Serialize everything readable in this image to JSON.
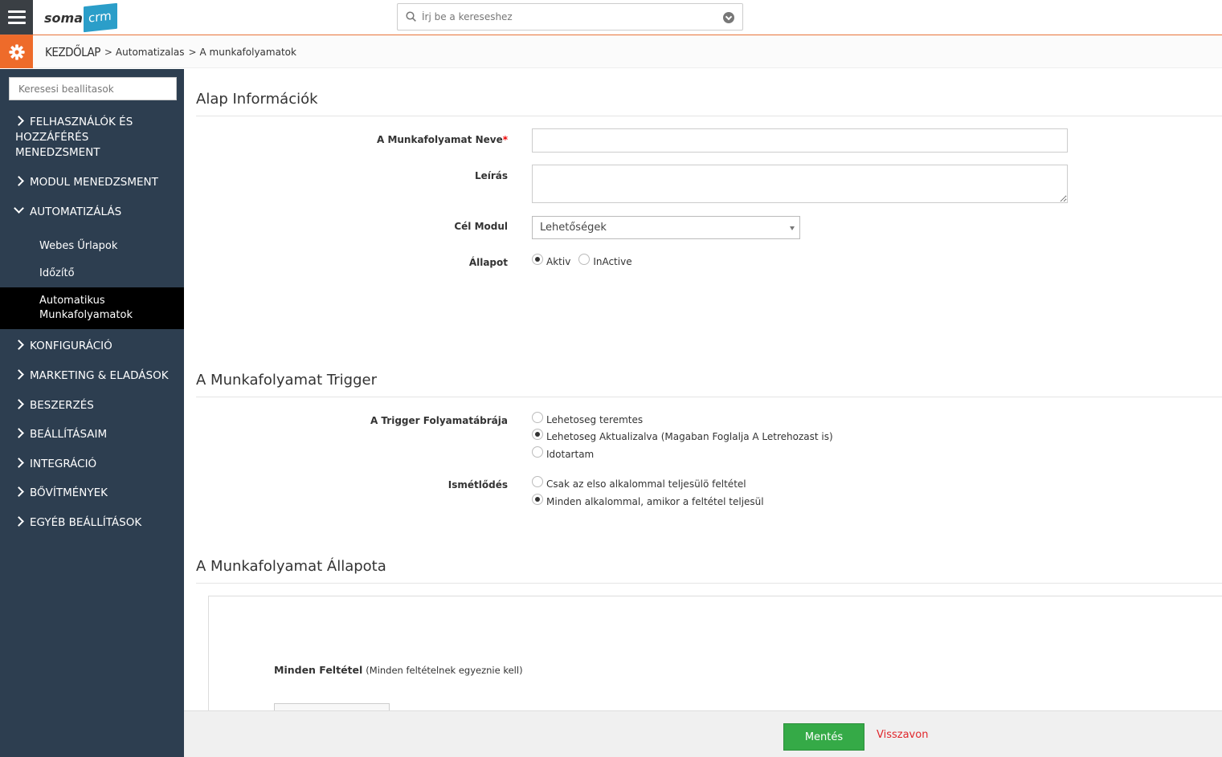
{
  "header": {
    "logo_text_1": "soma",
    "logo_text_2": "crm",
    "search_placeholder": "Írj be a kereseshez"
  },
  "breadcrumb": {
    "home": "KEZDŐLAP",
    "items": [
      "Automatizalas",
      "A munkafolyamatok"
    ]
  },
  "sidebar": {
    "search_placeholder": "Keresesi beallitasok",
    "items": [
      {
        "label": "FELHASZNÁLÓK ÉS HOZZÁFÉRÉS MENEDZSMENT"
      },
      {
        "label": "MODUL MENEDZSMENT"
      },
      {
        "label": "AUTOMATIZÁLÁS"
      },
      {
        "label": "KONFIGURÁCIÓ"
      },
      {
        "label": "MARKETING & ELADÁSOK"
      },
      {
        "label": "BESZERZÉS"
      },
      {
        "label": "BEÁLLÍTÁSAIM"
      },
      {
        "label": "INTEGRÁCIÓ"
      },
      {
        "label": "BŐVÍTMÉNYEK"
      },
      {
        "label": "EGYÉB BEÁLLÍTÁSOK"
      }
    ],
    "sub_items": [
      {
        "label": "Webes Űrlapok"
      },
      {
        "label": "Időzítő"
      },
      {
        "label": "Automatikus Munkafolyamatok",
        "active": true
      }
    ]
  },
  "basic_info": {
    "title": "Alap Információk",
    "name_label": "A Munkafolyamat Neve",
    "name_value": "",
    "desc_label": "Leírás",
    "desc_value": "",
    "module_label": "Cél Modul",
    "module_value": "Lehetőségek",
    "status_label": "Állapot",
    "status_options": [
      "Aktiv",
      "InActive"
    ],
    "status_selected": "Aktiv"
  },
  "trigger": {
    "title": "A Munkafolyamat Trigger",
    "flow_label": "A Trigger Folyamatábrája",
    "flow_options": [
      "Lehetoseg teremtes",
      "Lehetoseg Aktualizalva  (Magaban Foglalja A Letrehozast is)",
      "Idotartam"
    ],
    "flow_selected": 1,
    "repeat_label": "Ismétlődés",
    "repeat_options": [
      "Csak az elso alkalommal teljesülö feltétel",
      "Minden alkalommal, amikor a feltétel teljesül"
    ],
    "repeat_selected": 1
  },
  "status_section": {
    "title": "A Munkafolyamat Állapota",
    "all_conditions_bold": "Minden Feltétel",
    "all_conditions_note": "(Minden feltételnek egyeznie kell)"
  },
  "footer": {
    "save": "Mentés",
    "cancel": "Visszavon"
  },
  "colors": {
    "sidebar_bg": "#2d3e50",
    "accent_orange": "#ee6b2a",
    "save_green": "#35aa47",
    "cancel_red": "#e0262b",
    "logo_blue": "#2b9ec9"
  }
}
